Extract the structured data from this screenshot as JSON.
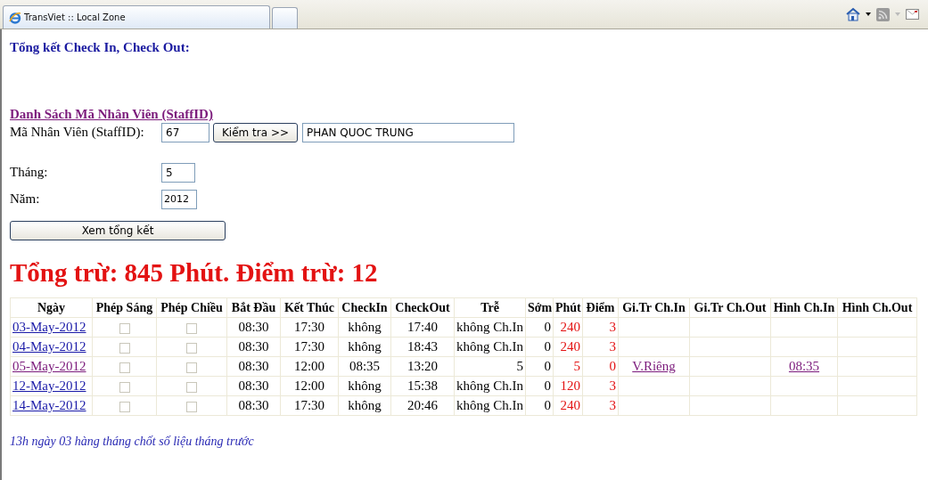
{
  "browser": {
    "tab_title": "TransViet :: Local Zone"
  },
  "page_title": "Tổng kết Check In, Check Out:",
  "staff_list_link": {
    "text": "Danh Sách Mã Nhân Viên (StaffID)",
    "visited": true
  },
  "form": {
    "staff_id": {
      "label": "Mã Nhân Viên (StaffID):",
      "value": "67"
    },
    "check_button": "Kiểm tra >>",
    "staff_name": "PHAN QUOC TRUNG",
    "month": {
      "label": "Tháng:",
      "value": "5"
    },
    "year": {
      "label": "Năm:",
      "value": "2012"
    },
    "summary_button": "Xem tổng kết"
  },
  "total": "Tổng trừ: 845 Phút. Điểm trừ: 12",
  "table": {
    "columns": [
      "Ngày",
      "Phép Sáng",
      "Phép Chiều",
      "Bắt Đầu",
      "Kết Thúc",
      "CheckIn",
      "CheckOut",
      "Trễ",
      "Sớm",
      "Phút",
      "Điểm",
      "Gi.Tr Ch.In",
      "Gi.Tr Ch.Out",
      "Hình Ch.In",
      "Hình Ch.Out"
    ],
    "rows": [
      {
        "cells": [
          {
            "kind": "link",
            "text": "03-May-2012",
            "visited": false
          },
          {
            "kind": "checkbox",
            "checked": false
          },
          {
            "kind": "checkbox",
            "checked": false
          },
          {
            "kind": "time",
            "text": "08:30"
          },
          {
            "kind": "time",
            "text": "17:30"
          },
          {
            "kind": "time",
            "text": "không"
          },
          {
            "kind": "time",
            "text": "17:40"
          },
          {
            "kind": "text",
            "text": "không Ch.In"
          },
          {
            "kind": "number",
            "text": "0"
          },
          {
            "kind": "number",
            "text": "240"
          },
          {
            "kind": "number",
            "text": "3"
          },
          {
            "kind": "empty"
          },
          {
            "kind": "empty"
          },
          {
            "kind": "empty"
          },
          {
            "kind": "empty"
          }
        ]
      },
      {
        "cells": [
          {
            "kind": "link",
            "text": "04-May-2012",
            "visited": false
          },
          {
            "kind": "checkbox",
            "checked": false
          },
          {
            "kind": "checkbox",
            "checked": false
          },
          {
            "kind": "time",
            "text": "08:30"
          },
          {
            "kind": "time",
            "text": "17:30"
          },
          {
            "kind": "time",
            "text": "không"
          },
          {
            "kind": "time",
            "text": "18:43"
          },
          {
            "kind": "text",
            "text": "không Ch.In"
          },
          {
            "kind": "number",
            "text": "0"
          },
          {
            "kind": "number",
            "text": "240"
          },
          {
            "kind": "number",
            "text": "3"
          },
          {
            "kind": "empty"
          },
          {
            "kind": "empty"
          },
          {
            "kind": "empty"
          },
          {
            "kind": "empty"
          }
        ]
      },
      {
        "cells": [
          {
            "kind": "link",
            "text": "05-May-2012",
            "visited": true
          },
          {
            "kind": "checkbox",
            "checked": false
          },
          {
            "kind": "checkbox",
            "checked": false
          },
          {
            "kind": "time",
            "text": "08:30"
          },
          {
            "kind": "time",
            "text": "12:00"
          },
          {
            "kind": "time",
            "text": "08:35"
          },
          {
            "kind": "time",
            "text": "13:20"
          },
          {
            "kind": "number",
            "text": "5"
          },
          {
            "kind": "number",
            "text": "0"
          },
          {
            "kind": "number",
            "text": "5"
          },
          {
            "kind": "number",
            "text": "0"
          },
          {
            "kind": "link",
            "text": "V.Riêng",
            "visited": true
          },
          {
            "kind": "empty"
          },
          {
            "kind": "link",
            "text": "08:35",
            "visited": true
          },
          {
            "kind": "empty"
          }
        ]
      },
      {
        "cells": [
          {
            "kind": "link",
            "text": "12-May-2012",
            "visited": false
          },
          {
            "kind": "checkbox",
            "checked": false
          },
          {
            "kind": "checkbox",
            "checked": false
          },
          {
            "kind": "time",
            "text": "08:30"
          },
          {
            "kind": "time",
            "text": "12:00"
          },
          {
            "kind": "time",
            "text": "không"
          },
          {
            "kind": "time",
            "text": "15:38"
          },
          {
            "kind": "text",
            "text": "không Ch.In"
          },
          {
            "kind": "number",
            "text": "0"
          },
          {
            "kind": "number",
            "text": "120"
          },
          {
            "kind": "number",
            "text": "3"
          },
          {
            "kind": "empty"
          },
          {
            "kind": "empty"
          },
          {
            "kind": "empty"
          },
          {
            "kind": "empty"
          }
        ]
      },
      {
        "cells": [
          {
            "kind": "link",
            "text": "14-May-2012",
            "visited": false
          },
          {
            "kind": "checkbox",
            "checked": false
          },
          {
            "kind": "checkbox",
            "checked": false
          },
          {
            "kind": "time",
            "text": "08:30"
          },
          {
            "kind": "time",
            "text": "17:30"
          },
          {
            "kind": "time",
            "text": "không"
          },
          {
            "kind": "time",
            "text": "20:46"
          },
          {
            "kind": "text",
            "text": "không Ch.In"
          },
          {
            "kind": "number",
            "text": "0"
          },
          {
            "kind": "number",
            "text": "240"
          },
          {
            "kind": "number",
            "text": "3"
          },
          {
            "kind": "empty"
          },
          {
            "kind": "empty"
          },
          {
            "kind": "empty"
          },
          {
            "kind": "empty"
          }
        ]
      }
    ]
  },
  "footer_note": "13h ngày 03 hàng tháng chốt số liệu tháng trước"
}
